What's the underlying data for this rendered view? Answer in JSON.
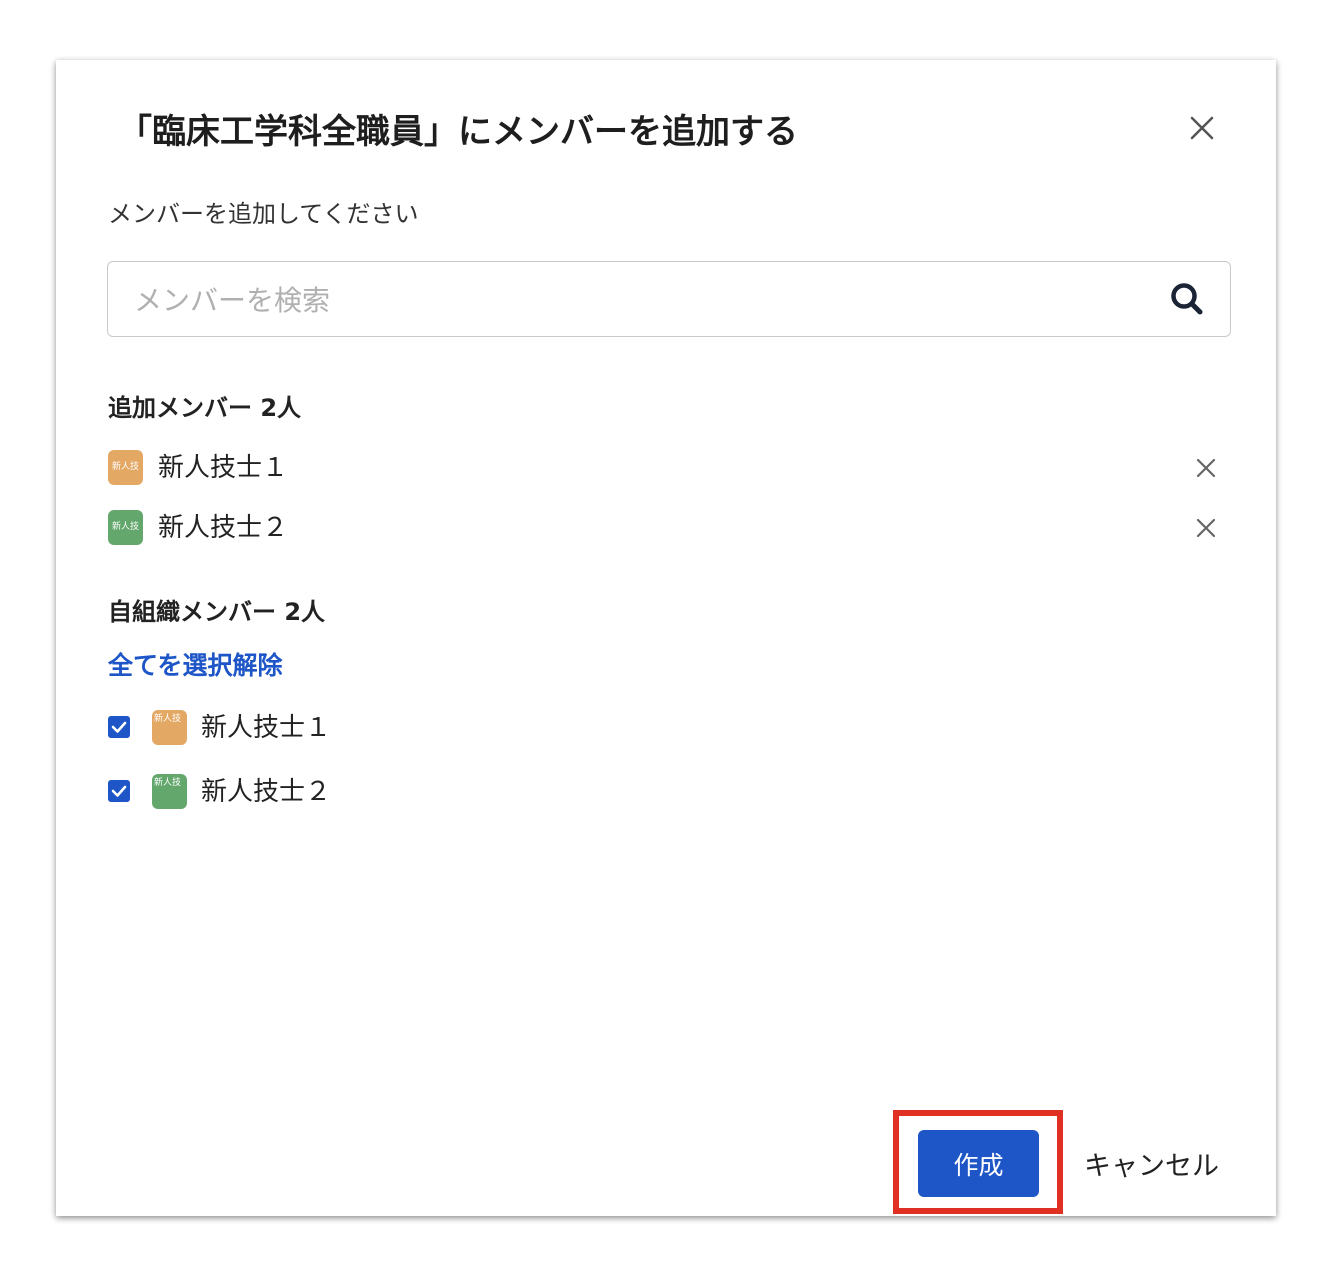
{
  "dialog": {
    "title": "「臨床工学科全職員」にメンバーを追加する",
    "subtitle": "メンバーを追加してください",
    "close_icon": "close-icon"
  },
  "search": {
    "placeholder": "メンバーを検索",
    "value": "",
    "icon": "search-icon"
  },
  "added_members": {
    "label": "追加メンバー 2人",
    "items": [
      {
        "avatar_text": "新人技",
        "avatar_color": "#e4a865",
        "name": "新人技士１"
      },
      {
        "avatar_text": "新人技",
        "avatar_color": "#63a76c",
        "name": "新人技士２"
      }
    ]
  },
  "org_members": {
    "label": "自組織メンバー 2人",
    "deselect_all": "全てを選択解除",
    "items": [
      {
        "checked": true,
        "avatar_text": "新人技",
        "avatar_color": "#e4a865",
        "name": "新人技士１"
      },
      {
        "checked": true,
        "avatar_text": "新人技",
        "avatar_color": "#63a76c",
        "name": "新人技士２"
      }
    ]
  },
  "footer": {
    "create_label": "作成",
    "cancel_label": "キャンセル"
  },
  "colors": {
    "accent": "#1e56c8",
    "highlight": "#e03024"
  }
}
